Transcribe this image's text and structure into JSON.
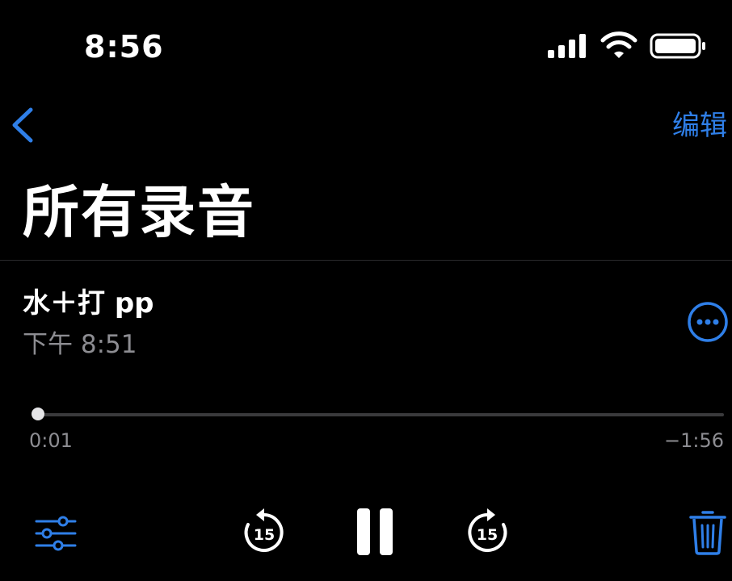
{
  "status_bar": {
    "time": "8:56",
    "signal_icon": "cellular-signal-icon",
    "wifi_icon": "wifi-icon",
    "battery_icon": "battery-icon"
  },
  "nav": {
    "back_icon": "chevron-left-icon",
    "edit_label": "编辑"
  },
  "page": {
    "title": "所有录音"
  },
  "recording": {
    "title": "水＋打 pp",
    "time": "下午 8:51",
    "more_icon": "ellipsis-circle-icon",
    "elapsed": "0:01",
    "remaining": "−1:56",
    "progress": 0.008
  },
  "controls": {
    "settings_icon": "sliders-icon",
    "skip_back_icon": "skip-back-15-icon",
    "skip_back_seconds": "15",
    "pause_icon": "pause-icon",
    "skip_forward_icon": "skip-forward-15-icon",
    "skip_forward_seconds": "15",
    "delete_icon": "trash-icon"
  },
  "colors": {
    "background": "#000000",
    "accent": "#2f7fe8",
    "secondary_text": "#8d8d92",
    "track": "#3a3a3c"
  }
}
